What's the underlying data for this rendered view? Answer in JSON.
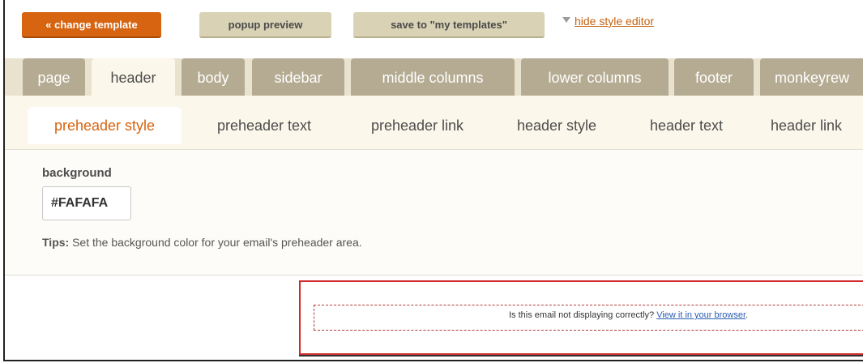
{
  "toolbar": {
    "change_template_label": "« change template",
    "popup_preview_label": "popup preview",
    "save_templates_label": "save to \"my templates\"",
    "hide_style_editor_label": "hide style editor"
  },
  "main_tabs": [
    {
      "label": "page",
      "active": false
    },
    {
      "label": "header",
      "active": true
    },
    {
      "label": "body",
      "active": false
    },
    {
      "label": "sidebar",
      "active": false
    },
    {
      "label": "middle columns",
      "active": false
    },
    {
      "label": "lower columns",
      "active": false
    },
    {
      "label": "footer",
      "active": false
    },
    {
      "label": "monkeyrew",
      "active": false
    }
  ],
  "sub_tabs": [
    {
      "label": "preheader style",
      "active": true
    },
    {
      "label": "preheader text",
      "active": false
    },
    {
      "label": "preheader link",
      "active": false
    },
    {
      "label": "header style",
      "active": false
    },
    {
      "label": "header text",
      "active": false
    },
    {
      "label": "header link",
      "active": false
    }
  ],
  "style_editor": {
    "field_label": "background",
    "field_value": "#FAFAFA",
    "tips_label": "Tips:",
    "tips_text": " Set the background color for your email's preheader area."
  },
  "preview": {
    "message": "Is this email not displaying correctly? ",
    "link_text": "View it in your browser",
    "message_end": "."
  },
  "colors": {
    "accent": "#d66410",
    "tab_inactive": "#b5ab92",
    "tab_active_bg": "#fbf7ea",
    "preview_border": "#cf2b2b",
    "link": "#2a5db0"
  }
}
